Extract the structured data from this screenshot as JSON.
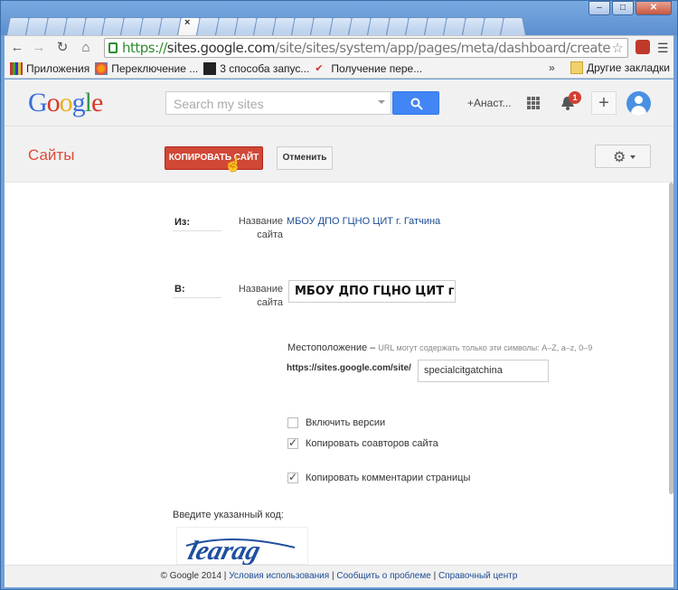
{
  "browser": {
    "close_tab": "×",
    "min": "–",
    "max": "□",
    "close": "✕",
    "url_scheme": "https://",
    "url_host": "sites.google.com",
    "url_path": "/site/sites/system/app/pages/meta/dashboard/create-new-site?",
    "bookmarks": [
      {
        "label": "Приложения",
        "icon": "apps-icon"
      },
      {
        "label": "Переключение ...",
        "icon": "joomla-icon"
      },
      {
        "label": "3 способа запус...",
        "icon": "bookmark-icon"
      },
      {
        "label": "Получение пере...",
        "icon": "check-icon"
      }
    ],
    "more": "»",
    "other_bookmarks": "Другие закладки"
  },
  "header": {
    "logo": "Google",
    "search_placeholder": "Search my sites",
    "user": "+Анаст...",
    "notifications": "1"
  },
  "toolbar": {
    "title": "Сайты",
    "copy_label": "КОПИРОВАТЬ САЙТ",
    "cancel_label": "Отменить"
  },
  "form": {
    "from_label": "Из:",
    "to_label": "В:",
    "site_name_label": "Название сайта",
    "from_site": "МБОУ ДПО ГЦНО ЦИТ г. Гатчина",
    "to_site_value": "МБОУ ДПО ГЦНО ЦИТ г. Г",
    "location_label": "Местоположение –",
    "location_hint": "URL могут содержать только эти символы: A–Z, a–z, 0–9",
    "location_prefix": "https://sites.google.com/site/",
    "location_value": "specialcitgatchina",
    "options": [
      {
        "label": "Включить версии",
        "checked": false
      },
      {
        "label": "Копировать соавторов сайта",
        "checked": true
      },
      {
        "label": "Копировать комментарии страницы",
        "checked": true
      }
    ],
    "captcha_label": "Введите указанный код:",
    "captcha_text": "learag"
  },
  "footer": {
    "copyright": "© Google 2014",
    "terms": "Условия использования",
    "report": "Сообщить о проблеме",
    "help": "Справочный центр"
  },
  "colors": {
    "accent_red": "#d14836",
    "link_blue": "#1c4c94",
    "search_blue": "#4285f4"
  }
}
